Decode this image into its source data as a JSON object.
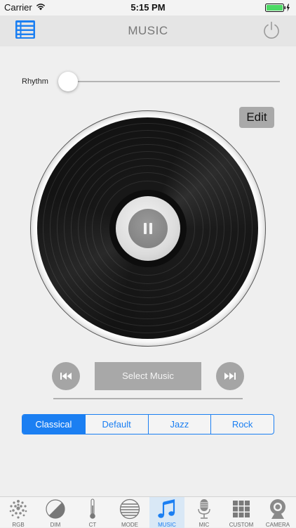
{
  "status_bar": {
    "carrier": "Carrier",
    "time": "5:15 PM"
  },
  "nav": {
    "title": "MUSIC",
    "menu_icon": "list-icon",
    "power_icon": "power-icon"
  },
  "rhythm": {
    "label": "Rhythm",
    "value": 0
  },
  "edit_label": "Edit",
  "player": {
    "select_label": "Select Music",
    "state": "paused"
  },
  "genres": {
    "items": [
      "Classical",
      "Default",
      "Jazz",
      "Rock"
    ],
    "selected": "Classical"
  },
  "tabs": [
    {
      "label": "RGB",
      "icon": "rgb-dots-icon"
    },
    {
      "label": "DIM",
      "icon": "dim-icon"
    },
    {
      "label": "CT",
      "icon": "thermometer-icon"
    },
    {
      "label": "MODE",
      "icon": "mode-icon"
    },
    {
      "label": "MUSIC",
      "icon": "music-note-icon",
      "active": true
    },
    {
      "label": "MIC",
      "icon": "microphone-icon"
    },
    {
      "label": "CUSTOM",
      "icon": "grid-icon"
    },
    {
      "label": "CAMERA",
      "icon": "camera-icon"
    }
  ],
  "colors": {
    "accent": "#1b7ff2",
    "battery": "#4cd964"
  }
}
